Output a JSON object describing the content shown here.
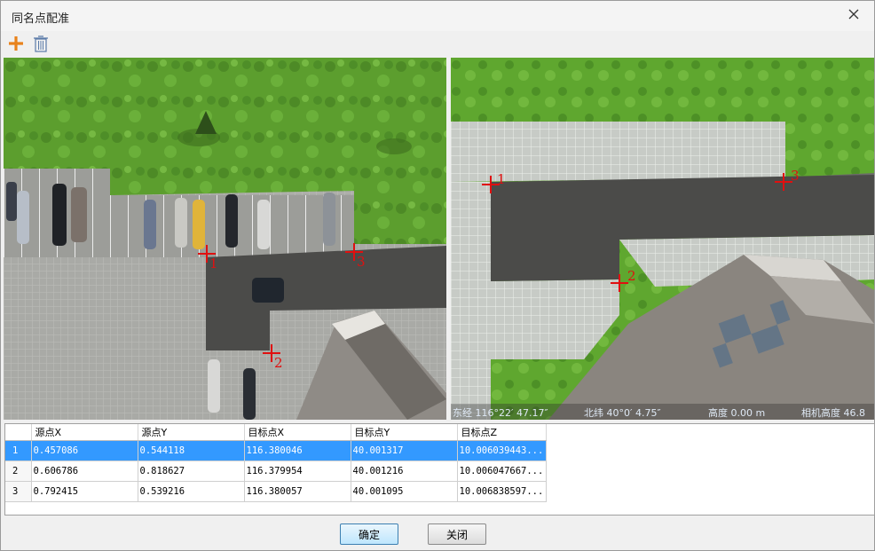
{
  "window": {
    "title": "同名点配准",
    "close_icon": "close-icon"
  },
  "toolbar": {
    "add_icon": "plus-icon",
    "delete_icon": "trash-icon",
    "add_color": "#e8821c"
  },
  "left_view": {
    "markers": [
      {
        "label": "1"
      },
      {
        "label": "2"
      },
      {
        "label": "3"
      }
    ]
  },
  "right_view": {
    "markers": [
      {
        "label": "1"
      },
      {
        "label": "2"
      },
      {
        "label": "3"
      }
    ],
    "status": {
      "lon": "东经 116°22′ 47.17″",
      "lat": "北纬 40°0′ 4.75″",
      "height": "高度 0.00 m",
      "cam": "相机高度 46.8"
    }
  },
  "table": {
    "columns": [
      "",
      "源点X",
      "源点Y",
      "目标点X",
      "目标点Y",
      "目标点Z"
    ],
    "rows": [
      {
        "n": "1",
        "sx": "0.457086",
        "sy": "0.544118",
        "tx": "116.380046",
        "ty": "40.001317",
        "tz": "10.006039443..."
      },
      {
        "n": "2",
        "sx": "0.606786",
        "sy": "0.818627",
        "tx": "116.379954",
        "ty": "40.001216",
        "tz": "10.006047667..."
      },
      {
        "n": "3",
        "sx": "0.792415",
        "sy": "0.539216",
        "tx": "116.380057",
        "ty": "40.001095",
        "tz": "10.006838597..."
      }
    ],
    "selected_row": 1,
    "selected_color": "#3399ff"
  },
  "footer": {
    "ok_label": "确定",
    "close_label": "关闭"
  },
  "colors": {
    "marker": "#e01010",
    "grass": "#5aa02c",
    "road": "#4a4a48"
  }
}
